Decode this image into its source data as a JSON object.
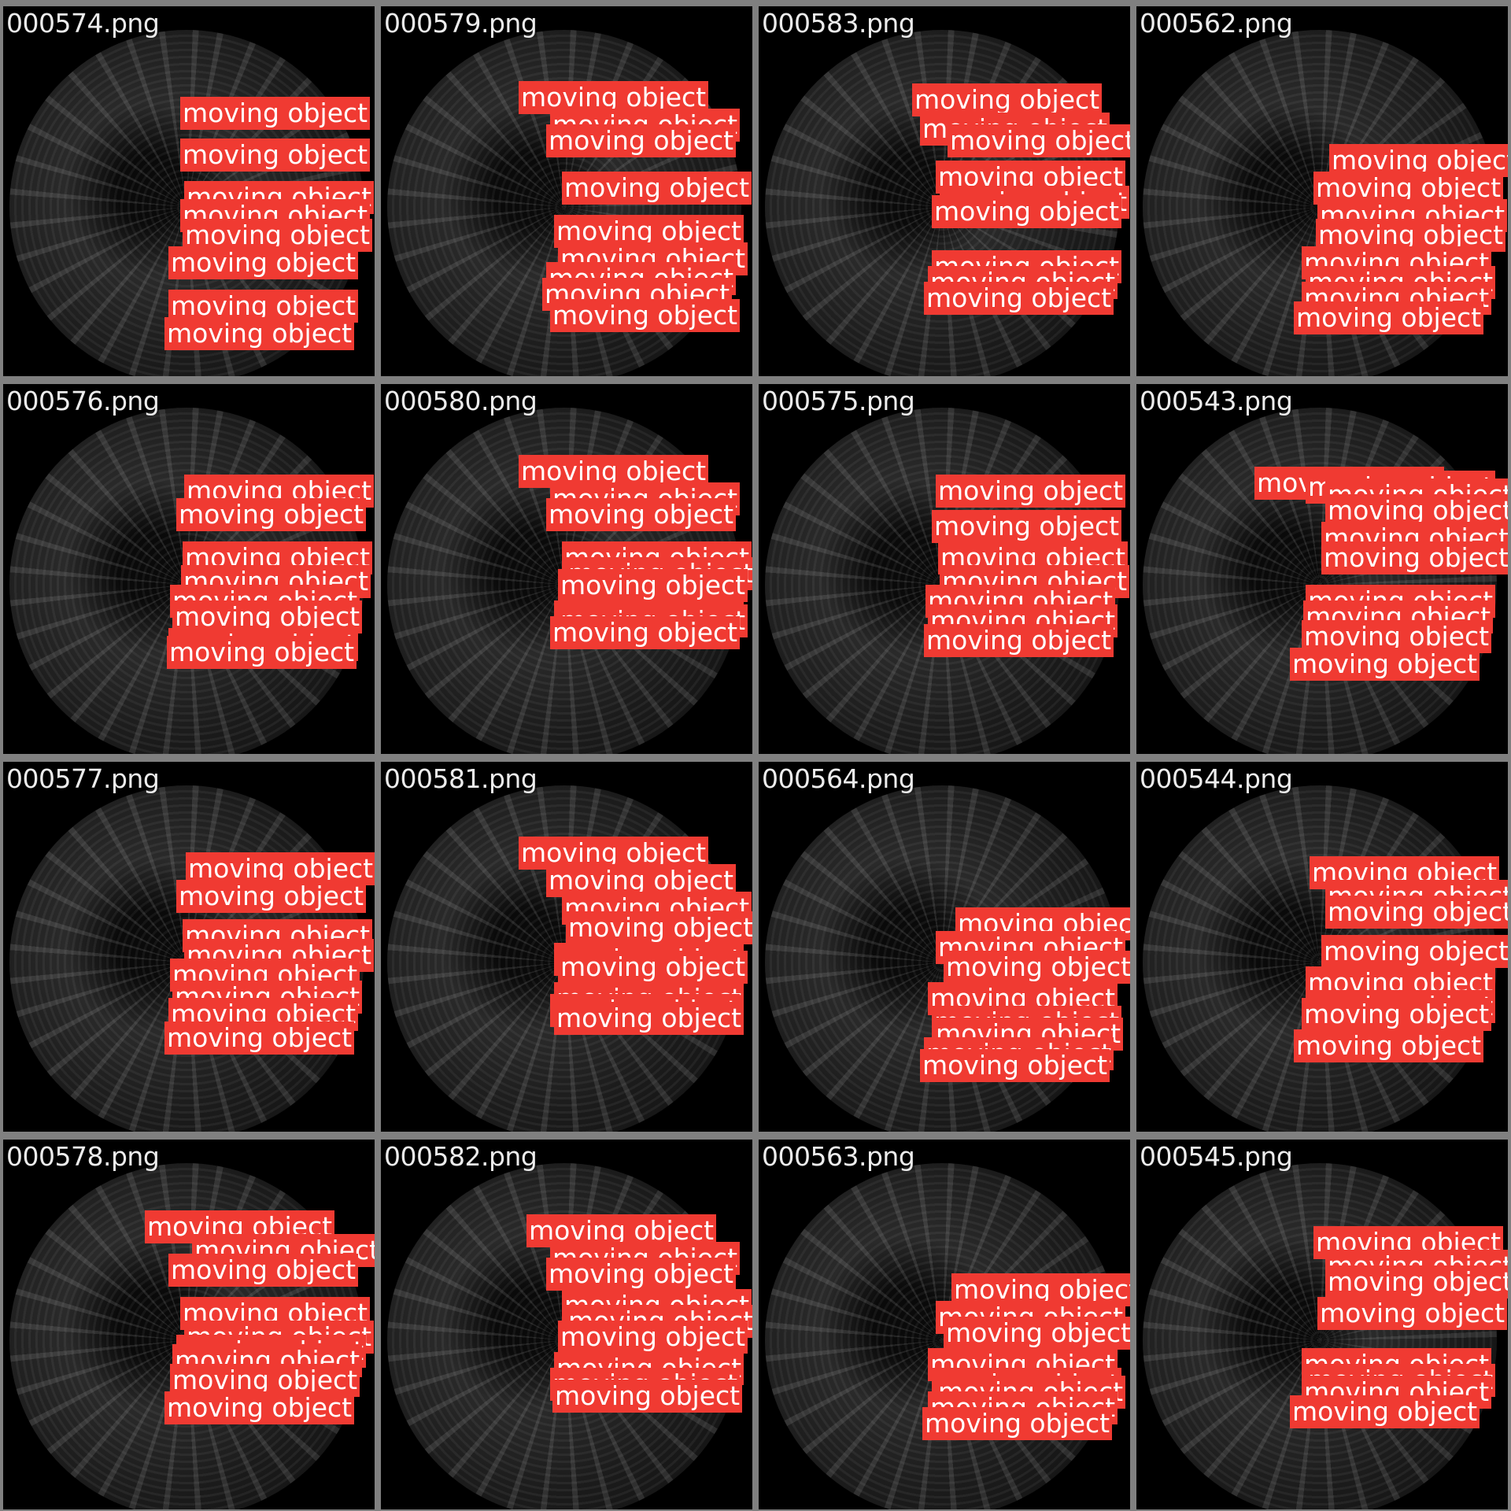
{
  "tiles": [
    {
      "filename": "000574.png",
      "detections": [
        "moving object",
        "moving object",
        "moving object",
        "moving object",
        "moving object",
        "moving object",
        "moving object",
        "moving object"
      ]
    },
    {
      "filename": "000579.png",
      "detections": [
        "moving object",
        "moving object",
        "moving object",
        "moving object",
        "moving object",
        "moving object",
        "moving object",
        "moving object",
        "moving object"
      ]
    },
    {
      "filename": "000583.png",
      "detections": [
        "moving object",
        "moving object",
        "moving object",
        "moving object",
        "moving object",
        "moving object",
        "moving object",
        "moving object",
        "moving object"
      ]
    },
    {
      "filename": "000562.png",
      "detections": [
        "moving object",
        "moving object",
        "moving object",
        "moving object",
        "moving object",
        "moving object",
        "moving object",
        "moving object"
      ]
    },
    {
      "filename": "000576.png",
      "detections": [
        "moving object",
        "moving object",
        "moving object",
        "moving object",
        "moving object",
        "moving object",
        "moving object",
        "moving object"
      ]
    },
    {
      "filename": "000580.png",
      "detections": [
        "moving object",
        "moving object",
        "moving object",
        "moving object",
        "moving object",
        "moving object",
        "moving object",
        "moving object",
        "moving object"
      ]
    },
    {
      "filename": "000575.png",
      "detections": [
        "moving object",
        "moving object",
        "moving object",
        "moving object",
        "moving object",
        "moving object",
        "moving object"
      ]
    },
    {
      "filename": "000543.png",
      "detections": [
        "moving object",
        "moving object",
        "moving object",
        "moving object",
        "moving object",
        "moving object",
        "moving object",
        "moving object",
        "moving object",
        "moving object"
      ]
    },
    {
      "filename": "000577.png",
      "detections": [
        "moving object",
        "moving object",
        "moving object",
        "moving object",
        "moving object",
        "moving object",
        "moving object",
        "moving object"
      ]
    },
    {
      "filename": "000581.png",
      "detections": [
        "moving object",
        "moving object",
        "moving object",
        "moving object",
        "moving object",
        "moving object",
        "moving object",
        "moving object",
        "moving object"
      ]
    },
    {
      "filename": "000564.png",
      "detections": [
        "moving object",
        "moving object",
        "moving object",
        "moving object",
        "moving object",
        "moving object",
        "moving object",
        "moving object"
      ]
    },
    {
      "filename": "000544.png",
      "detections": [
        "moving object",
        "moving object",
        "moving object",
        "moving object",
        "moving object",
        "moving object",
        "moving object",
        "moving object"
      ]
    },
    {
      "filename": "000578.png",
      "detections": [
        "moving object",
        "moving object",
        "moving object",
        "moving object",
        "moving object",
        "moving object",
        "moving object",
        "moving object",
        "moving object"
      ]
    },
    {
      "filename": "000582.png",
      "detections": [
        "moving object",
        "moving object",
        "moving object",
        "moving object",
        "moving object",
        "moving object",
        "moving object",
        "moving object",
        "moving object"
      ]
    },
    {
      "filename": "000563.png",
      "detections": [
        "moving object",
        "moving object",
        "moving object",
        "moving object",
        "moving object",
        "moving object",
        "moving object",
        "moving object"
      ]
    },
    {
      "filename": "000545.png",
      "detections": [
        "moving object",
        "moving object",
        "moving object",
        "moving object",
        "moving object",
        "moving object",
        "moving object",
        "moving object"
      ]
    }
  ],
  "colors": {
    "label_background": "#f03a32",
    "label_text": "#ffffff",
    "filename_text": "#ececec",
    "frame": "#808080"
  }
}
